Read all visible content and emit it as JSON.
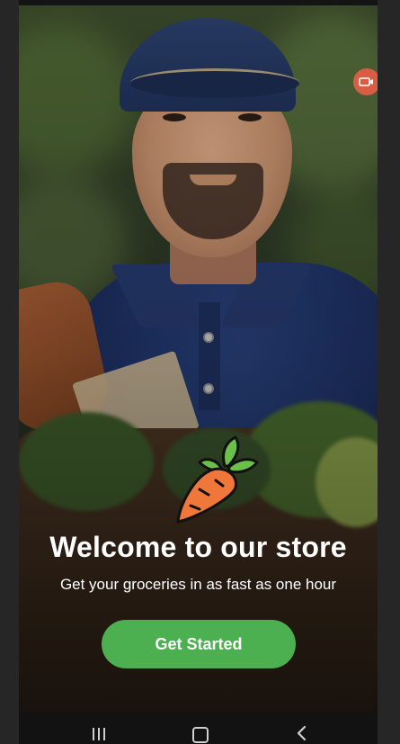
{
  "hero": {
    "title": "Welcome to our store",
    "subtitle": "Get your groceries in as fast as one hour",
    "cta_label": "Get Started",
    "logo_icon": "carrot-icon"
  },
  "overlay_badge": {
    "icon": "video-record-icon",
    "color": "#d95c45"
  },
  "navbar": {
    "buttons": [
      "recents-icon",
      "home-icon",
      "back-icon"
    ]
  },
  "colors": {
    "accent": "#4caf50",
    "text": "#ffffff"
  }
}
